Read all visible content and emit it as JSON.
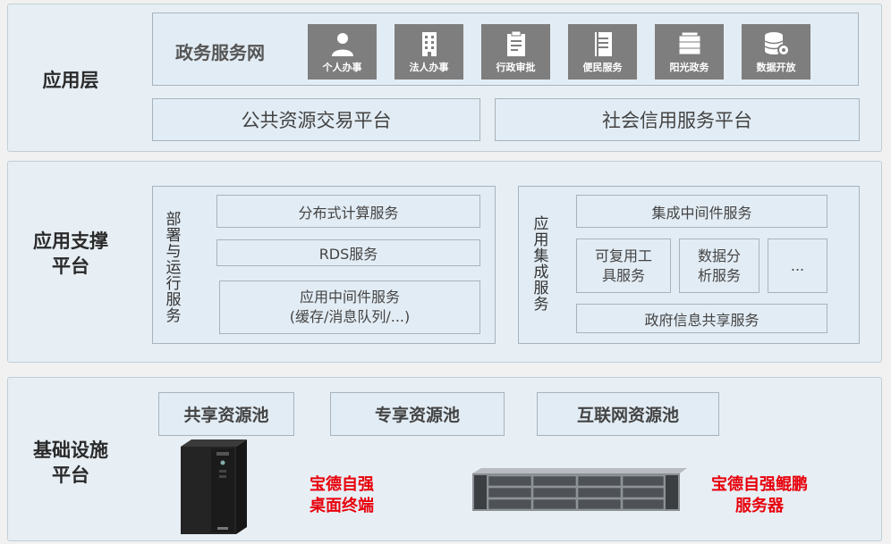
{
  "app_layer": {
    "title": "应用层",
    "gov_net": "政务服务网",
    "tiles": [
      "个人办事",
      "法人办事",
      "行政审批",
      "便民服务",
      "阳光政务",
      "数据开放"
    ],
    "public_resource": "公共资源交易平台",
    "social_credit": "社会信用服务平台"
  },
  "support_layer": {
    "title_line1": "应用支撑",
    "title_line2": "平台",
    "deploy_label": "部署与运行服务",
    "distributed": "分布式计算服务",
    "rds": "RDS服务",
    "middleware_line1": "应用中间件服务",
    "middleware_line2": "(缓存/消息队列/...)",
    "integration_label": "应用集成服务",
    "integration_mw": "集成中间件服务",
    "reusable_line1": "可复用工",
    "reusable_line2": "具服务",
    "data_line1": "数据分",
    "data_line2": "析服务",
    "ellipsis": "...",
    "gov_share": "政府信息共享服务"
  },
  "infra_layer": {
    "title_line1": "基础设施",
    "title_line2": "平台",
    "shared_pool": "共享资源池",
    "dedicated_pool": "专享资源池",
    "internet_pool": "互联网资源池",
    "desktop_line1": "宝德自强",
    "desktop_line2": "桌面终端",
    "server_line1": "宝德自强鲲鹏",
    "server_line2": "服务器"
  },
  "colors": {
    "accent_red": "#e8000b",
    "tile_gray": "#7e7e7e",
    "panel_bg": "#e7eff5"
  }
}
